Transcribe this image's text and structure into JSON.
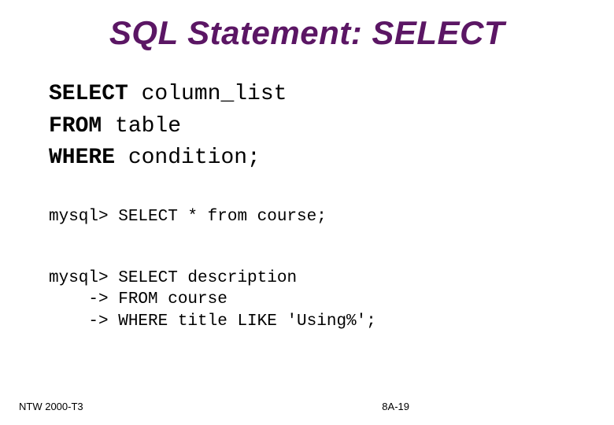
{
  "title": "SQL Statement: SELECT",
  "syntax": {
    "kw_select": "SELECT",
    "select_args": " column_list",
    "kw_from": "FROM",
    "from_args": " table",
    "kw_where": "WHERE",
    "where_args": " condition;"
  },
  "example1": "mysql> SELECT * from course;",
  "example2": "mysql> SELECT description\n    -> FROM course\n    -> WHERE title LIKE 'Using%';",
  "footer_left": "NTW 2000-T3",
  "footer_right": "8A-19"
}
